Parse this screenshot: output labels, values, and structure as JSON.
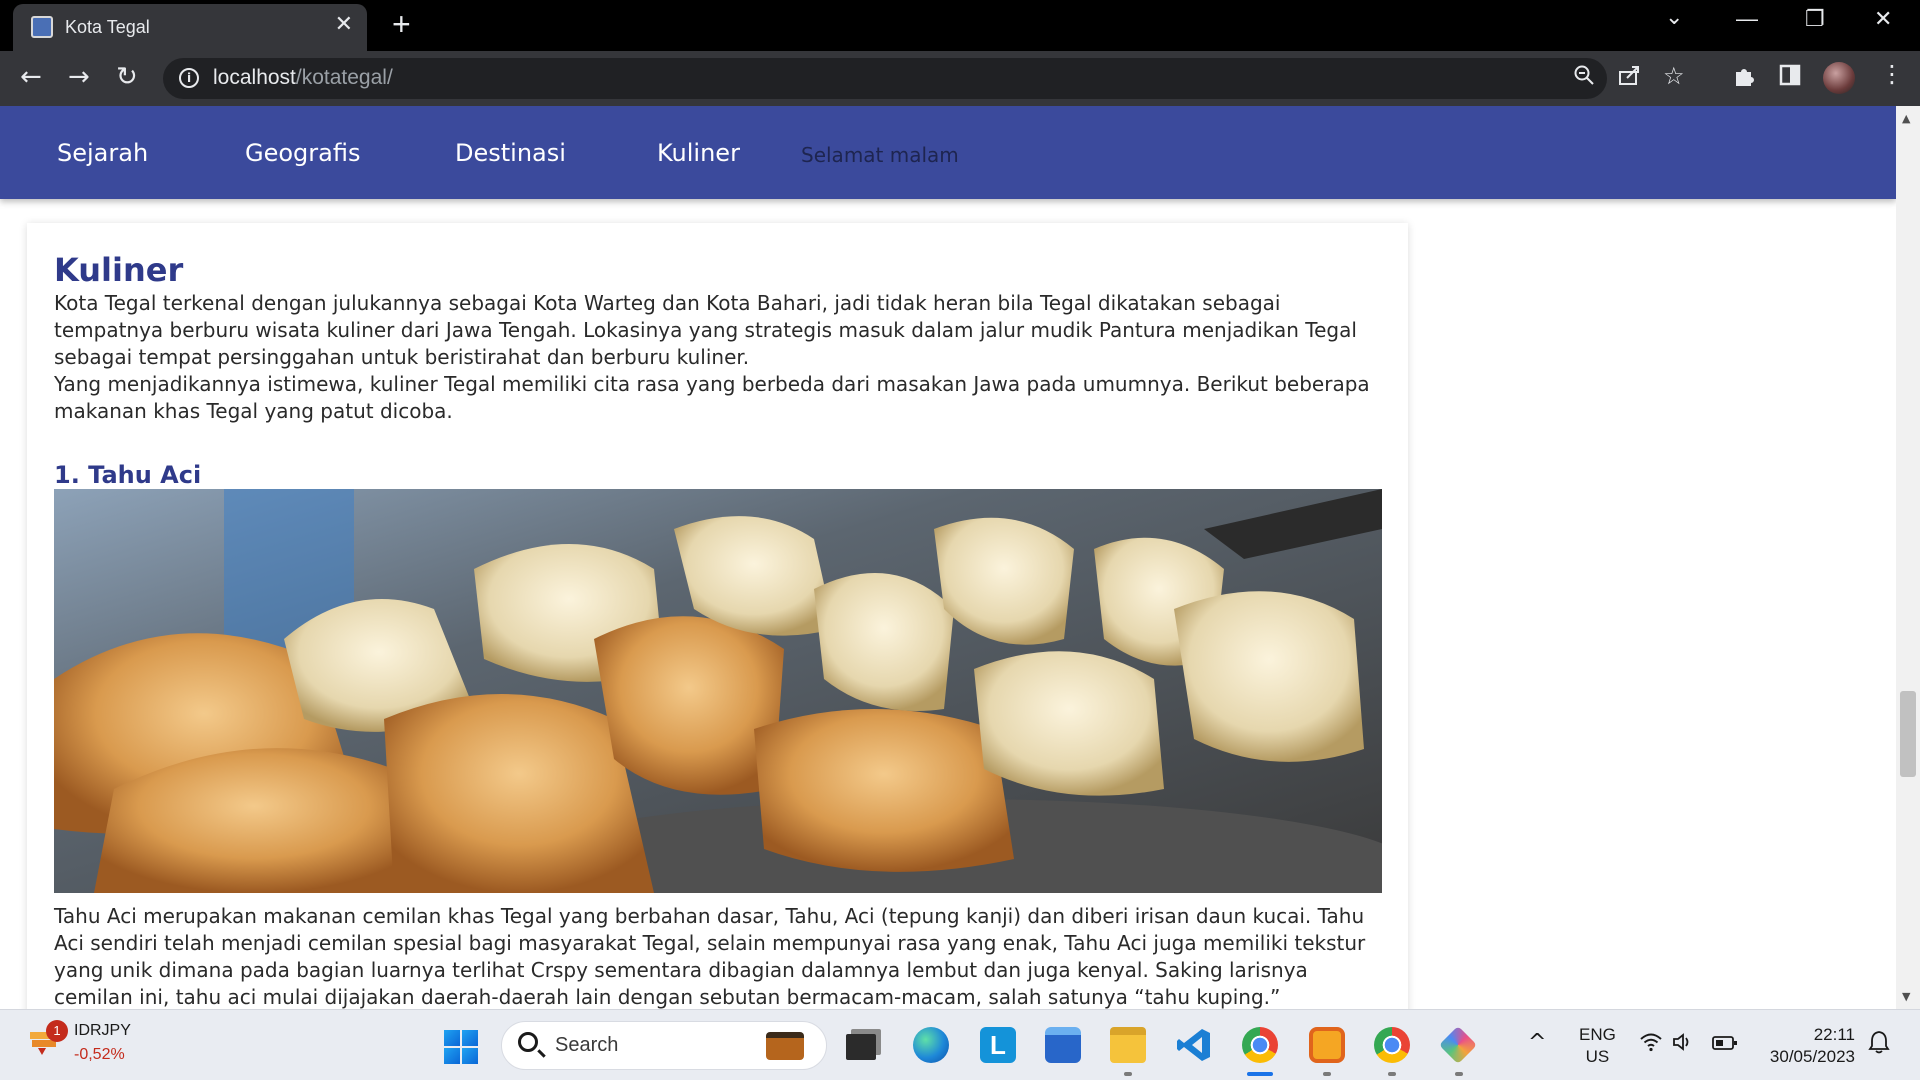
{
  "browser": {
    "tab_title": "Kota Tegal",
    "tab_close": "✕",
    "new_tab": "+",
    "url_host": "localhost",
    "url_path": "/kotategal/",
    "window_controls": [
      "⌄",
      "—",
      "❐",
      "✕"
    ]
  },
  "page": {
    "nav": {
      "items": [
        "Sejarah",
        "Geografis",
        "Destinasi",
        "Kuliner"
      ],
      "greeting": "Selamat malam"
    },
    "section_title": "Kuliner",
    "intro_1": "Kota Tegal terkenal dengan julukannya sebagai Kota Warteg dan Kota Bahari, jadi tidak heran bila Tegal dikatakan sebagai tempatnya berburu wisata kuliner dari Jawa Tengah. Lokasinya yang strategis masuk dalam jalur mudik Pantura menjadikan Tegal sebagai tempat persinggahan untuk beristirahat dan berburu kuliner.",
    "intro_2": "Yang menjadikannya istimewa, kuliner Tegal memiliki cita rasa yang berbeda dari masakan Jawa pada umumnya. Berikut beberapa makanan khas Tegal yang patut dicoba.",
    "item_title": "1. Tahu Aci",
    "item_desc": "Tahu Aci merupakan makanan cemilan khas Tegal yang berbahan dasar, Tahu, Aci (tepung kanji) dan diberi irisan daun kucai. Tahu Aci sendiri telah menjadi cemilan spesial bagi masyarakat Tegal, selain mempunyai rasa yang enak, Tahu Aci juga memiliki tekstur yang unik dimana pada bagian luarnya terlihat Crspy sementara dibagian dalamnya lembut dan juga kenyal. Saking larisnya cemilan ini, tahu aci mulai dijajakan daerah-daerah lain dengan sebutan bermacam-macam, salah satunya “tahu kuping.”"
  },
  "taskbar": {
    "ticker_badge": "1",
    "ticker_name": "IDRJPY",
    "ticker_value": "-0,52%",
    "search_label": "Search",
    "lang_top": "ENG",
    "lang_bottom": "US",
    "time": "22:11",
    "date": "30/05/2023"
  },
  "colors": {
    "nav_bg": "#3b4a9c",
    "heading": "#2f3a8a",
    "ticker_negative": "#c42b1c"
  }
}
